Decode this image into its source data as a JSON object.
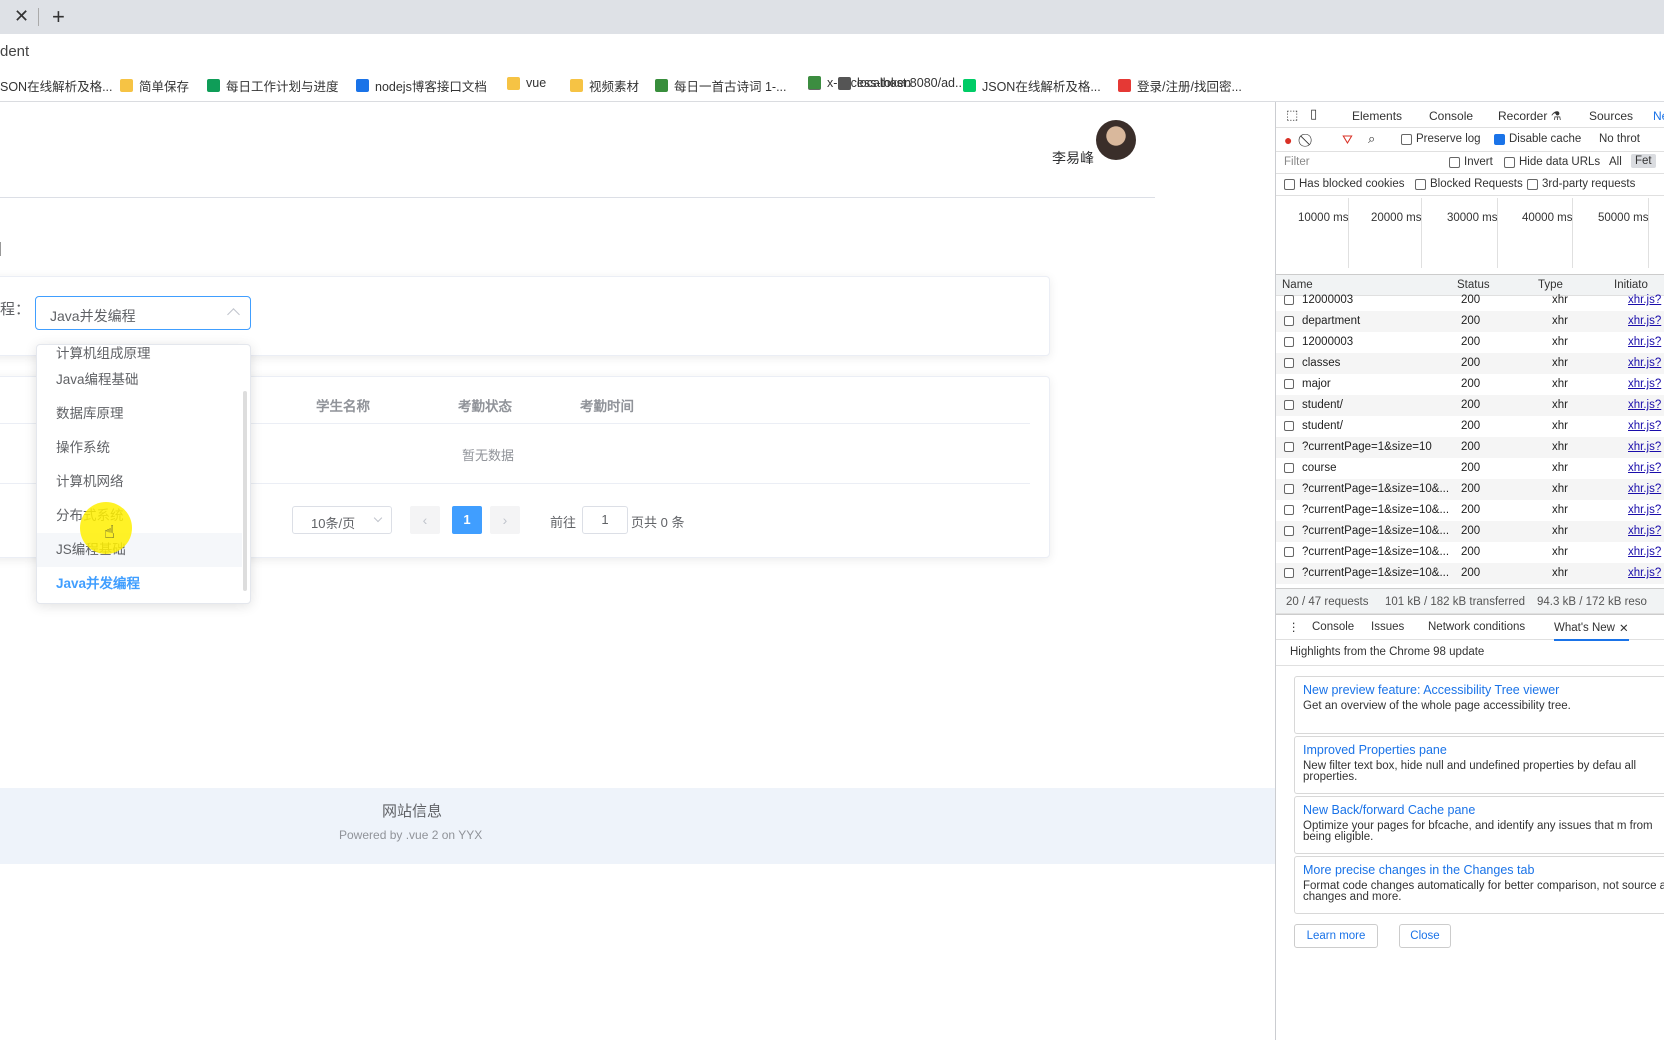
{
  "browser": {
    "url_fragment": "dent",
    "bookmarks": [
      {
        "label": "SON在线解析及格...",
        "color": ""
      },
      {
        "label": "简单保存",
        "color": "#f6c344"
      },
      {
        "label": "每日工作计划与进度",
        "color": "#0f9d58"
      },
      {
        "label": "nodejs博客接口文档",
        "color": "#1a73e8"
      },
      {
        "label": "vue",
        "color": "#f6c344"
      },
      {
        "label": "视频素材",
        "color": "#f6c344"
      },
      {
        "label": "每日一首古诗词 1-...",
        "color": "#388e3c"
      },
      {
        "label": "x-access-token",
        "color": "#666"
      },
      {
        "label": "localhost:8080/ad...",
        "color": "#555"
      },
      {
        "label": "JSON在线解析及格...",
        "color": "#0c6"
      },
      {
        "label": "登录/注册/找回密...",
        "color": "#e53935"
      }
    ]
  },
  "header": {
    "username": "李易峰"
  },
  "filter": {
    "label": "程：",
    "selected": "Java并发编程"
  },
  "dropdown": {
    "options": [
      "计算机组成原理",
      "Java编程基础",
      "数据库原理",
      "操作系统",
      "计算机网络",
      "分布式系统",
      "JS编程基础",
      "Java并发编程"
    ],
    "hover_index": 6,
    "selected_index": 7
  },
  "table": {
    "columns": [
      "学生名称",
      "考勤状态",
      "考勤时间"
    ],
    "empty_text": "暂无数据"
  },
  "pagination": {
    "page_size": "10条/页",
    "current_page": "1",
    "goto_label": "前往",
    "goto_value": "1",
    "total": "页共 0 条",
    "prev": "‹",
    "next": "›"
  },
  "footer": {
    "title": "网站信息",
    "subtitle": "Powered by .vue 2 on YYX"
  },
  "devtools": {
    "tabs": [
      "Elements",
      "Console",
      "Recorder ⚗",
      "Sources",
      "Ne"
    ],
    "toolbar": {
      "preserve_log": "Preserve log",
      "disable_cache": "Disable cache",
      "throttle": "No throt"
    },
    "filter_placeholder": "Filter",
    "invert": "Invert",
    "hide_data_urls": "Hide data URLs",
    "all": "All",
    "fetch": "Fet",
    "has_blocked_cookies": "Has blocked cookies",
    "blocked_requests": "Blocked Requests",
    "third_party": "3rd-party requests",
    "timeline": [
      "10000 ms",
      "20000 ms",
      "30000 ms",
      "40000 ms",
      "50000 ms"
    ],
    "columns": [
      "Name",
      "Status",
      "Type",
      "Initiato"
    ],
    "requests": [
      {
        "name": "12000003",
        "status": "200",
        "type": "xhr",
        "initiator": "xhr.js?"
      },
      {
        "name": "department",
        "status": "200",
        "type": "xhr",
        "initiator": "xhr.js?"
      },
      {
        "name": "12000003",
        "status": "200",
        "type": "xhr",
        "initiator": "xhr.js?"
      },
      {
        "name": "classes",
        "status": "200",
        "type": "xhr",
        "initiator": "xhr.js?"
      },
      {
        "name": "major",
        "status": "200",
        "type": "xhr",
        "initiator": "xhr.js?"
      },
      {
        "name": "student/",
        "status": "200",
        "type": "xhr",
        "initiator": "xhr.js?"
      },
      {
        "name": "student/",
        "status": "200",
        "type": "xhr",
        "initiator": "xhr.js?"
      },
      {
        "name": "?currentPage=1&size=10",
        "status": "200",
        "type": "xhr",
        "initiator": "xhr.js?"
      },
      {
        "name": "course",
        "status": "200",
        "type": "xhr",
        "initiator": "xhr.js?"
      },
      {
        "name": "?currentPage=1&size=10&...",
        "status": "200",
        "type": "xhr",
        "initiator": "xhr.js?"
      },
      {
        "name": "?currentPage=1&size=10&...",
        "status": "200",
        "type": "xhr",
        "initiator": "xhr.js?"
      },
      {
        "name": "?currentPage=1&size=10&...",
        "status": "200",
        "type": "xhr",
        "initiator": "xhr.js?"
      },
      {
        "name": "?currentPage=1&size=10&...",
        "status": "200",
        "type": "xhr",
        "initiator": "xhr.js?"
      },
      {
        "name": "?currentPage=1&size=10&...",
        "status": "200",
        "type": "xhr",
        "initiator": "xhr.js?"
      },
      {
        "name": "?currentPage=1&size=10&...",
        "status": "200",
        "type": "xhr",
        "initiator": "xhr.js?"
      }
    ],
    "status_bar": {
      "requests": "20 / 47 requests",
      "transferred": "101 kB / 182 kB transferred",
      "resources": "94.3 kB / 172 kB reso"
    },
    "drawer_tabs": [
      "Console",
      "Issues",
      "Network conditions",
      "What's New"
    ],
    "whats_new_heading": "Highlights from the Chrome 98 update",
    "news": [
      {
        "title": "New preview feature: Accessibility Tree viewer",
        "desc": "Get an overview of the whole page accessibility tree."
      },
      {
        "title": "Improved Properties pane",
        "desc": "New filter text box, hide null and undefined properties by defau all properties."
      },
      {
        "title": "New Back/forward Cache pane",
        "desc": "Optimize your pages for bfcache, and identify any issues that m from being eligible."
      },
      {
        "title": "More precise changes in the Changes tab",
        "desc": "Format code changes automatically for better comparison, not source as changes and more."
      }
    ],
    "learn_more": "Learn more",
    "close": "Close"
  }
}
